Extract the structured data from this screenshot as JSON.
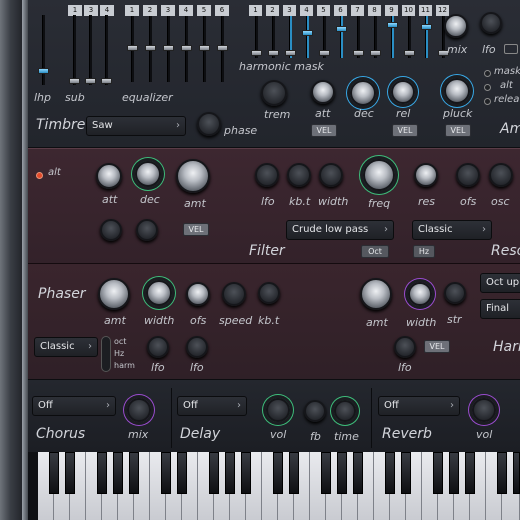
{
  "top": {
    "lowpass_numbers": [
      "1",
      "3",
      "4"
    ],
    "eq_numbers": [
      "1",
      "2",
      "3",
      "4",
      "5",
      "6"
    ],
    "harmonic_numbers": [
      "1",
      "2",
      "3",
      "4",
      "5",
      "6",
      "7",
      "8",
      "9",
      "10",
      "11",
      "12"
    ],
    "labels": {
      "lhp": "lhp",
      "sub": "sub",
      "equalizer": "equalizer",
      "harmonic_mask": "harmonic mask",
      "mix": "mix",
      "lfo": "lfo",
      "trem": "trem",
      "att": "att",
      "dec": "dec",
      "rel": "rel",
      "pluck": "pluck",
      "phase": "phase",
      "timbre": "Timbre",
      "am": "Am"
    },
    "timbre_select": "Saw",
    "vel_label": "VEL",
    "options": [
      "mask",
      "alt",
      "relea"
    ]
  },
  "filter": {
    "alt_label": "alt",
    "labels": {
      "att": "att",
      "dec": "dec",
      "amt": "amt",
      "lfo": "lfo",
      "kbt": "kb.t",
      "width": "width",
      "freq": "freq",
      "res": "res",
      "ofs": "ofs",
      "osc": "osc",
      "filter": "Filter",
      "reso": "Reso"
    },
    "vel_label": "VEL",
    "type_select": "Crude low pass",
    "mode_select": "Classic",
    "oct_label": "Oct",
    "hz_label": "Hz"
  },
  "phaser": {
    "title": "Phaser",
    "labels": {
      "amt": "amt",
      "width": "width",
      "ofs": "ofs",
      "speed": "speed",
      "kbt": "kb.t",
      "lfo1": "lfo",
      "lfo2": "lfo",
      "amt2": "amt",
      "width2": "width",
      "str": "str",
      "lfo3": "lfo",
      "harm": "Harm"
    },
    "mode_select": "Classic",
    "options": [
      "oct",
      "Hz",
      "harm"
    ],
    "vel_label": "VEL",
    "right_select1": "Oct up",
    "right_select2": "Final"
  },
  "fx": {
    "chorus": {
      "title": "Chorus",
      "select": "Off",
      "mix_label": "mix"
    },
    "delay": {
      "title": "Delay",
      "select": "Off",
      "vol_label": "vol",
      "fb_label": "fb",
      "time_label": "time"
    },
    "reverb": {
      "title": "Reverb",
      "select": "Off",
      "vol_label": "vol"
    }
  },
  "colors": {
    "accent_blue": "#38a8e6",
    "accent_green": "#3dbd7a",
    "accent_purple": "#9a4ccf",
    "filter_bg": "#3d2730"
  }
}
